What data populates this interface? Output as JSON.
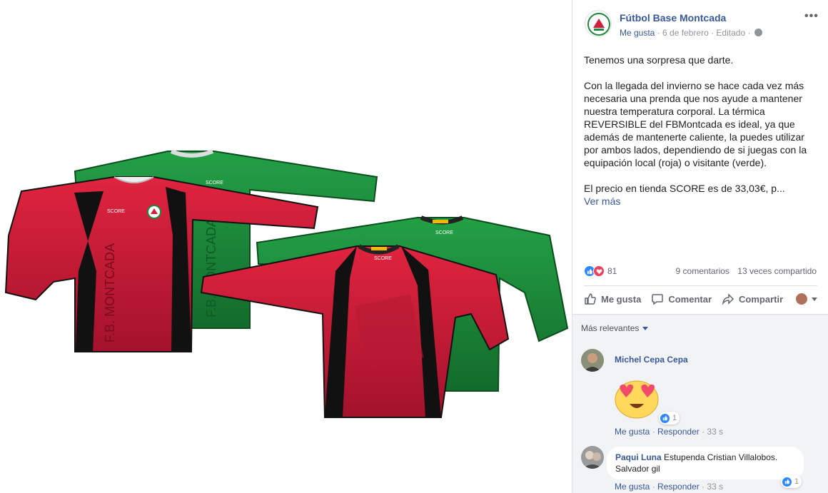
{
  "post": {
    "page_name": "Fútbol Base Montcada",
    "meta_like": "Me gusta",
    "meta_dot1": " · ",
    "date": "6 de febrero",
    "meta_dot2": " · ",
    "edited": "Editado",
    "meta_dot3": " · ",
    "paragraphs": [
      "Tenemos una sorpresa que darte.",
      "Con la llegada del invierno se hace cada vez más necesaria una prenda que nos ayude a mantener nuestra temperatura corporal. La térmica REVERSIBLE del FBMontcada es ideal, ya que además de mantenerte caliente, la puedes utilizar por ambos lados, dependiendo de si juegas con la equipación local (roja) o visitante (verde).",
      "El precio en tienda SCORE es de 33,03€, p..."
    ],
    "see_more": "Ver más"
  },
  "photo": {
    "shirt_texts": [
      "F.B. MONTCADA",
      "SCORE"
    ]
  },
  "stats": {
    "reaction_count": "81",
    "comments": "9 comentarios",
    "shares": "13 veces compartido"
  },
  "actions": {
    "like": "Me gusta",
    "comment": "Comentar",
    "share": "Compartir"
  },
  "comments_section": {
    "sort_label": "Más relevantes",
    "comments": [
      {
        "author": "Michel Cepa Cepa",
        "text": "",
        "like_count": "1",
        "like_label": "Me gusta",
        "reply_label": "Responder",
        "time": "33 s"
      },
      {
        "author": "Paqui Luna",
        "text": "Estupenda Cristian Villalobos. Salvador gil",
        "like_count": "1",
        "like_label": "Me gusta",
        "reply_label": "Responder",
        "time": "33 s"
      }
    ]
  },
  "colors": {
    "link": "#385898",
    "red_shirt": "#d11f3c",
    "green_shirt": "#1f8a3a",
    "like_blue": "#2d88ff",
    "love_red": "#f33e58"
  }
}
